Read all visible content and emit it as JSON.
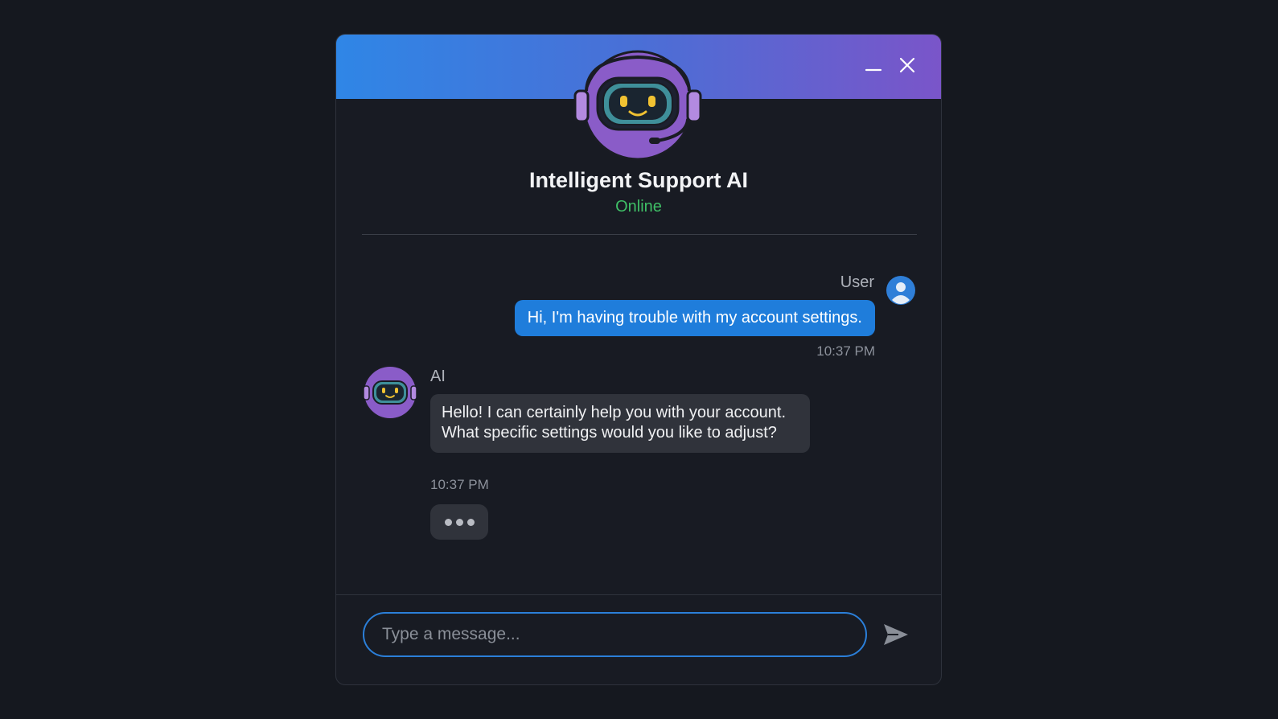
{
  "header": {
    "title": "Intelligent Support AI",
    "status": "Online",
    "minimize_icon": "minimize-icon",
    "close_icon": "close-icon"
  },
  "messages": [
    {
      "sender": "User",
      "text": "Hi, I'm having trouble with my account settings.",
      "time": "10:37 PM"
    },
    {
      "sender": "AI",
      "text": "Hello! I can certainly help you with your account. What specific settings would you like to adjust?",
      "time": "10:37 PM"
    }
  ],
  "typing_indicator": "...",
  "composer": {
    "placeholder": "Type a message...",
    "send_icon": "send-icon"
  },
  "colors": {
    "accent": "#1f7ddb",
    "online": "#3fbf66",
    "header_gradient_start": "#2f86e6",
    "header_gradient_end": "#7a55c9",
    "bot_purple": "#8a5cc8"
  }
}
